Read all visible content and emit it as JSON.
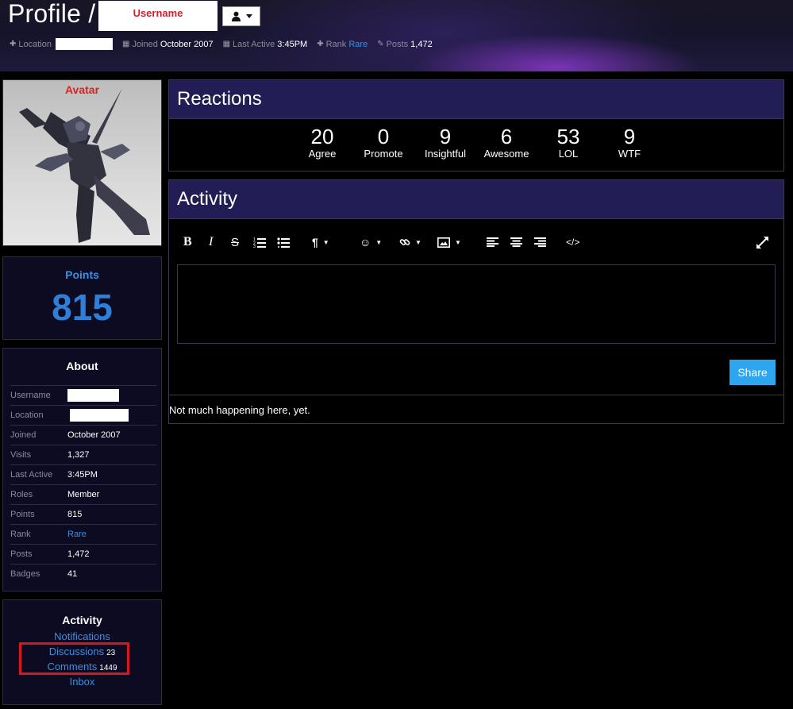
{
  "header": {
    "title": "Profile /",
    "username_placeholder": "Username",
    "meta": {
      "location_label": "Location",
      "joined_label": "Joined",
      "joined_value": "October 2007",
      "last_active_label": "Last Active",
      "last_active_value": "3:45PM",
      "rank_label": "Rank",
      "rank_value": "Rare",
      "posts_label": "Posts",
      "posts_value": "1,472"
    }
  },
  "avatar": {
    "label": "Avatar"
  },
  "points": {
    "title": "Points",
    "value": "815"
  },
  "about": {
    "title": "About",
    "rows": [
      {
        "key": "Username",
        "value": ""
      },
      {
        "key": "Location",
        "value": ""
      },
      {
        "key": "Joined",
        "value": "October 2007"
      },
      {
        "key": "Visits",
        "value": "1,327"
      },
      {
        "key": "Last Active",
        "value": "3:45PM"
      },
      {
        "key": "Roles",
        "value": "Member"
      },
      {
        "key": "Points",
        "value": "815"
      },
      {
        "key": "Rank",
        "value": "Rare"
      },
      {
        "key": "Posts",
        "value": "1,472"
      },
      {
        "key": "Badges",
        "value": "41"
      }
    ]
  },
  "activity_side": {
    "title": "Activity",
    "notifications": "Notifications",
    "discussions": "Discussions",
    "discussions_count": "23",
    "comments": "Comments",
    "comments_count": "1449",
    "inbox": "Inbox"
  },
  "reactions": {
    "title": "Reactions",
    "items": [
      {
        "count": "20",
        "label": "Agree"
      },
      {
        "count": "0",
        "label": "Promote"
      },
      {
        "count": "9",
        "label": "Insightful"
      },
      {
        "count": "6",
        "label": "Awesome"
      },
      {
        "count": "53",
        "label": "LOL"
      },
      {
        "count": "9",
        "label": "WTF"
      }
    ]
  },
  "activity": {
    "title": "Activity",
    "toolbar": [
      "bold-icon",
      "italic-icon",
      "strikethrough-icon",
      "ordered-list-icon",
      "bullet-list-icon",
      "paragraph-format-icon",
      "emoji-icon",
      "link-icon",
      "image-icon",
      "align-left-icon",
      "align-center-icon",
      "align-right-icon",
      "code-icon",
      "fullscreen-icon"
    ],
    "share_label": "Share",
    "empty_text": "Not much happening here, yet."
  },
  "colors": {
    "accent_blue": "#3b8fe0",
    "share_button": "#2da5ef",
    "panel_header": "#221d55",
    "highlight_red": "#d9161c"
  }
}
